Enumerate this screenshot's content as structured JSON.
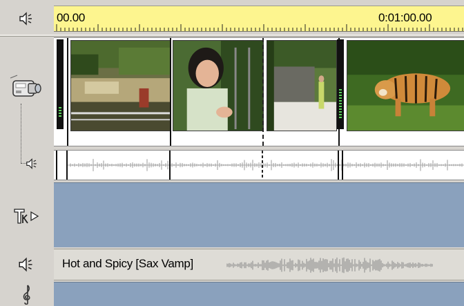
{
  "ruler": {
    "start_time": "00.00",
    "marker_time": "0:01:00.00"
  },
  "tracks": {
    "video": {
      "clips": [
        {
          "name": "zoo-enclosure-clip"
        },
        {
          "name": "girl-closeup-clip"
        },
        {
          "name": "zoo-path-clip"
        },
        {
          "name": "tiger-clip"
        }
      ]
    },
    "music": {
      "clip_label": "Hot and Spicy [Sax Vamp]"
    }
  },
  "icons": {
    "ruler_speaker": "speaker-icon",
    "video": "video-camera-icon",
    "video_audio": "speaker-icon",
    "title": "title-text-icon",
    "music": "speaker-icon",
    "score": "treble-clef-icon"
  },
  "colors": {
    "ruler_bg": "#fdf58f",
    "track_blue": "#8aa1bd",
    "panel_gray": "#d6d3ce"
  }
}
